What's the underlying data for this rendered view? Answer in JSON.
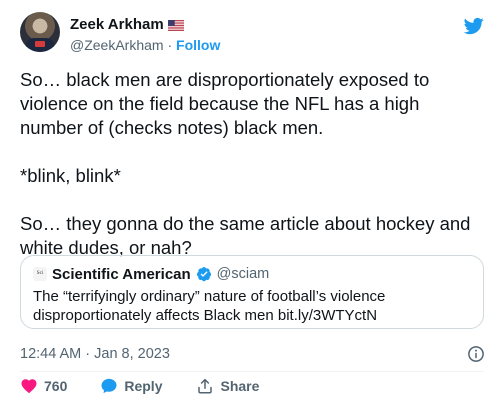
{
  "user": {
    "display_name": "Zeek Arkham",
    "handle": "@ZeekArkham",
    "separator": "·",
    "follow_label": "Follow"
  },
  "tweet": {
    "text": "So… black men are disproportionately exposed to violence on the field because the NFL has a high number of (checks notes) black men.\n\n*blink, blink*\n\nSo… they gonna do the same article about hockey and white dudes, or nah?"
  },
  "quote": {
    "logo_text": "Sci Am",
    "name": "Scientific American",
    "handle": "@sciam",
    "text": "The “terrifyingly ordinary” nature of football’s violence disproportionately affects Black men bit.ly/3WTYctN"
  },
  "meta": {
    "timestamp": "12:44 AM · Jan 8, 2023"
  },
  "actions": {
    "like_count": "760",
    "reply_label": "Reply",
    "share_label": "Share"
  },
  "colors": {
    "accent": "#1d9bf0",
    "like": "#f91880",
    "text": "#0f1419",
    "muted": "#536471"
  },
  "icons": [
    "twitter-bird-icon",
    "us-flag-icon",
    "verified-badge-icon",
    "info-icon",
    "heart-icon",
    "reply-bubble-icon",
    "share-icon"
  ]
}
